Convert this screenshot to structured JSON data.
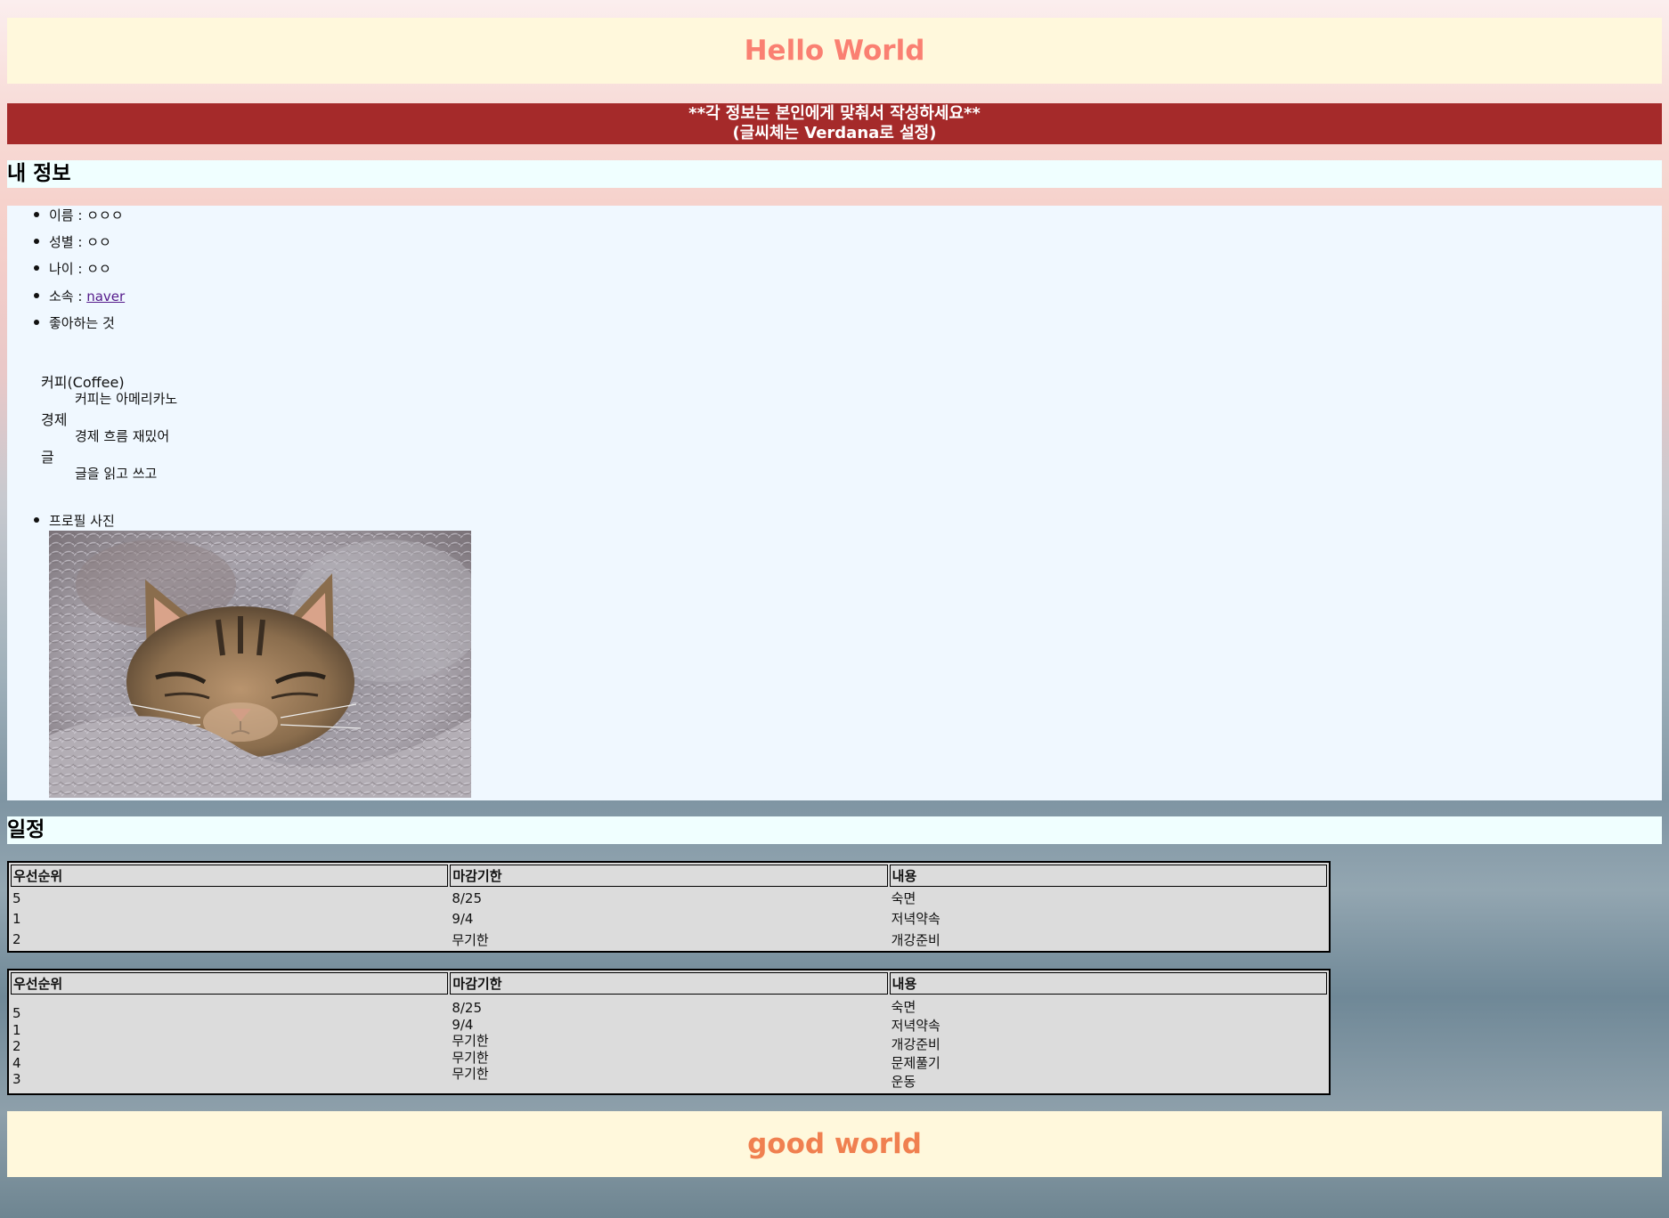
{
  "header": {
    "title": "Hello World"
  },
  "notice": {
    "line1": "**각 정보는 본인에게 맞춰서 작성하세요**",
    "line2": "(글씨체는 Verdana로 설정)"
  },
  "my_info": {
    "heading": "내 정보",
    "name": "이름 : ㅇㅇㅇ",
    "gender": "성별 : ㅇㅇ",
    "age": "나이 : ㅇㅇ",
    "affiliation_label": "소속 : ",
    "affiliation_link": "naver",
    "likes_label": "좋아하는 것",
    "likes": [
      {
        "term": "커피(Coffee)",
        "desc": "커피는 아메리카노"
      },
      {
        "term": "경제",
        "desc": "경제 흐름 재밌어"
      },
      {
        "term": "글",
        "desc": "글을 읽고 쓰고"
      }
    ],
    "photo_label": "프로필 사진"
  },
  "schedule": {
    "heading": "일정",
    "columns": [
      "우선순위",
      "마감기한",
      "내용"
    ],
    "table1": {
      "rows": [
        [
          "5",
          "8/25",
          "숙면"
        ],
        [
          "1",
          "9/4",
          "저녁약속"
        ],
        [
          "2",
          "무기한",
          "개강준비"
        ]
      ]
    },
    "table2": {
      "priorities": [
        "5",
        "1",
        "2",
        "4",
        "3"
      ],
      "deadlines": [
        "8/25",
        "9/4",
        "무기한",
        "무기한",
        "무기한"
      ],
      "contents": [
        "숙면",
        "저녁약속",
        "개강준비",
        "문제풀기",
        "운동"
      ]
    }
  },
  "footer": {
    "title": "good world"
  },
  "colors": {
    "header_bg": "#fff8dc",
    "header_text": "#fa8072",
    "notice_bg": "#a52a2a",
    "heading_bg": "#f0ffff",
    "info_bg": "#f0f8ff",
    "table_bg": "#dcdcdc",
    "footer_text": "#f08050"
  }
}
